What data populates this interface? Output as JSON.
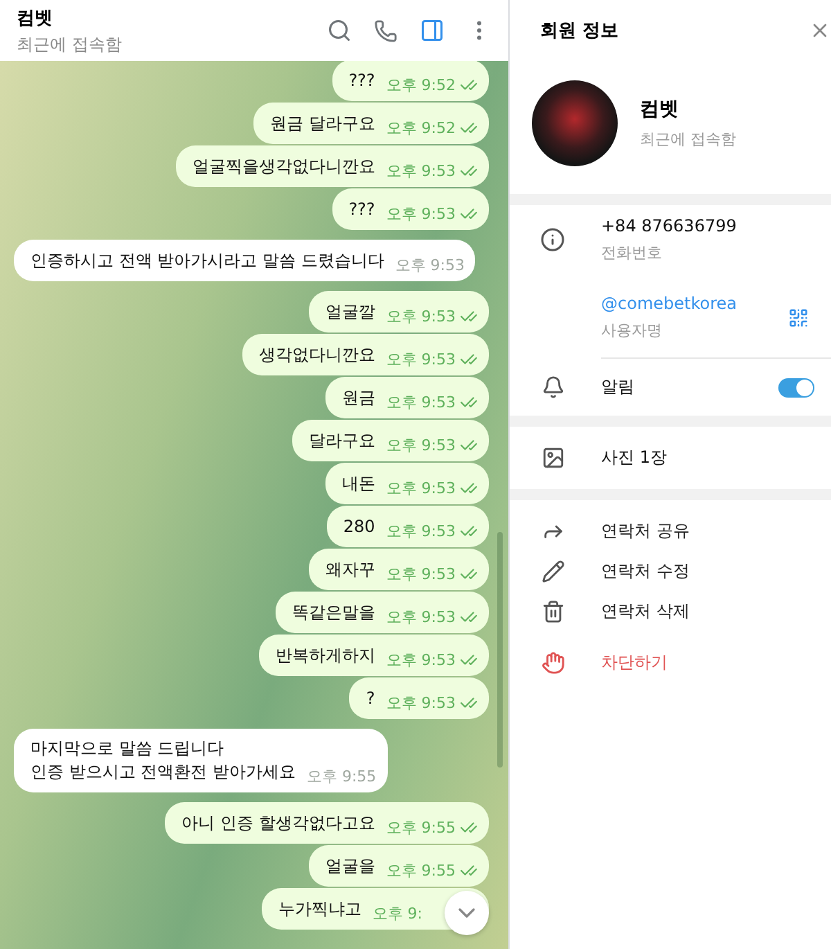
{
  "chat_header": {
    "name": "컴벳",
    "status": "최근에 접속함",
    "side_panel_open": true
  },
  "messages": [
    {
      "kind": "out",
      "text": "???",
      "time": "오후 9:52",
      "read": true
    },
    {
      "kind": "out",
      "text": "원금 달라구요",
      "time": "오후 9:52",
      "read": true
    },
    {
      "kind": "out",
      "text": "얼굴찍을생각없다니깐요",
      "time": "오후 9:53",
      "read": true
    },
    {
      "kind": "out",
      "text": "???",
      "time": "오후 9:53",
      "read": true
    },
    {
      "kind": "in",
      "text": "인증하시고 전액 받아가시라고 말씀 드렸습니다",
      "time": "오후 9:53"
    },
    {
      "kind": "out",
      "text": "얼굴깔",
      "time": "오후 9:53",
      "read": true
    },
    {
      "kind": "out",
      "text": "생각없다니깐요",
      "time": "오후 9:53",
      "read": true
    },
    {
      "kind": "out",
      "text": "원금",
      "time": "오후 9:53",
      "read": true
    },
    {
      "kind": "out",
      "text": "달라구요",
      "time": "오후 9:53",
      "read": true
    },
    {
      "kind": "out",
      "text": "내돈",
      "time": "오후 9:53",
      "read": true
    },
    {
      "kind": "out",
      "text": "280",
      "time": "오후 9:53",
      "read": true
    },
    {
      "kind": "out",
      "text": "왜자꾸",
      "time": "오후 9:53",
      "read": true
    },
    {
      "kind": "out",
      "text": "똑같은말을",
      "time": "오후 9:53",
      "read": true
    },
    {
      "kind": "out",
      "text": "반복하게하지",
      "time": "오후 9:53",
      "read": true
    },
    {
      "kind": "out",
      "text": "?",
      "time": "오후 9:53",
      "read": true
    },
    {
      "kind": "in",
      "lines": [
        "마지막으로 말씀 드립니다",
        "인증 받으시고 전액환전 받아가세요"
      ],
      "time": "오후 9:55"
    },
    {
      "kind": "out",
      "text": "아니 인증 할생각없다고요",
      "time": "오후 9:55",
      "read": true
    },
    {
      "kind": "out",
      "text": "얼굴을",
      "time": "오후 9:55",
      "read": true
    },
    {
      "kind": "out",
      "text": "누가찍냐고",
      "time": "오후 9:"
    }
  ],
  "profile_panel": {
    "title": "회원 정보",
    "name": "컴벳",
    "status": "최근에 접속함",
    "phone": {
      "value": "+84 876636799",
      "label": "전화번호"
    },
    "username": {
      "value": "@comebetkorea",
      "label": "사용자명"
    },
    "notifications": {
      "label": "알림",
      "on": true
    },
    "photos": "사진 1장",
    "actions": [
      {
        "kind": "share",
        "label": "연락처 공유"
      },
      {
        "kind": "edit",
        "label": "연락처 수정"
      },
      {
        "kind": "delete",
        "label": "연락처 삭제"
      },
      {
        "kind": "block",
        "label": "차단하기"
      }
    ]
  }
}
